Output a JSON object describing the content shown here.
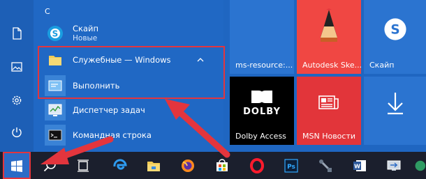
{
  "start_menu": {
    "section_letter": "С",
    "apps": [
      {
        "name": "Скайп",
        "subtitle": "Новые",
        "icon": "skype-icon"
      },
      {
        "name": "Служебные — Windows",
        "icon": "folder-icon",
        "expanded": true
      },
      {
        "name": "Выполнить",
        "icon": "run-icon"
      },
      {
        "name": "Диспетчер задач",
        "icon": "task-manager-icon"
      },
      {
        "name": "Командная строка",
        "icon": "command-prompt-icon"
      }
    ],
    "rail_icons": [
      "document-icon",
      "pictures-icon",
      "settings-icon",
      "power-icon"
    ]
  },
  "tiles": [
    {
      "label": "ms-resource:...",
      "icon": "ms-resource-icon",
      "color": "#2b74d0"
    },
    {
      "label": "Autodesk Ske...",
      "icon": "autodesk-sketchbook-icon",
      "color": "#f04743"
    },
    {
      "label": "Скайп",
      "icon": "skype-icon",
      "color": "#2b74d0"
    },
    {
      "label": "Dolby Access",
      "icon": "dolby-icon",
      "color": "#000000"
    },
    {
      "label": "MSN Новости",
      "icon": "msn-news-icon",
      "color": "#e2353a"
    },
    {
      "label": "",
      "icon": "download-icon",
      "color": "#2b74d0"
    }
  ],
  "tile_art_text": {
    "dolby": "DOLBY",
    "ps": "Ps"
  },
  "taskbar_icons": [
    "windows-start-icon",
    "search-icon",
    "task-view-icon",
    "edge-icon",
    "file-explorer-icon",
    "firefox-icon",
    "store-icon",
    "opera-icon",
    "photoshop-icon",
    "tools-icon",
    "word-icon",
    "remote-desktop-icon",
    "app-icon"
  ],
  "colors": {
    "accent": "#1f66c1",
    "highlight": "#e3353d",
    "taskbar": "#1b1f2d"
  }
}
